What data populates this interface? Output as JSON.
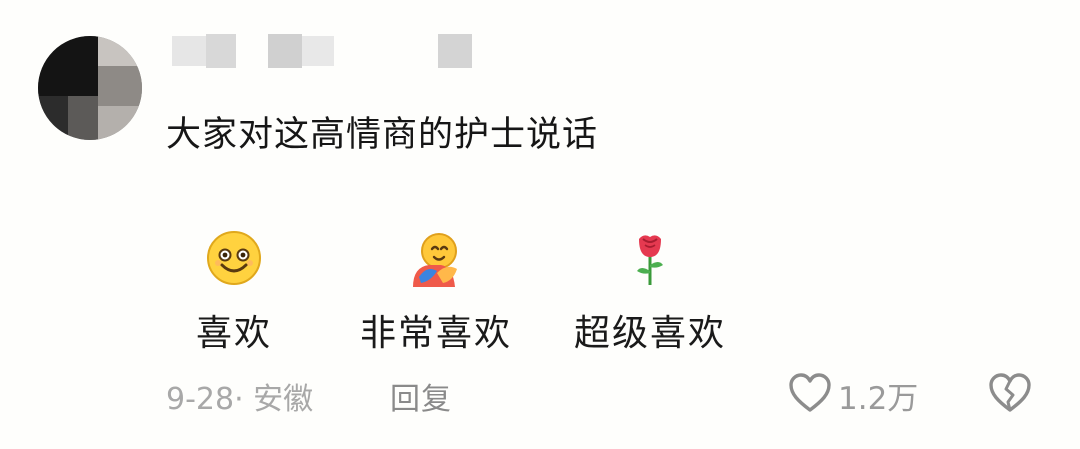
{
  "comment": {
    "text": "大家对这高情商的护士说话",
    "avatar_icon": "user-avatar-pixelated",
    "reactions": [
      {
        "icon": "smiling-face-emoji",
        "label": "喜欢"
      },
      {
        "icon": "hugging-face-emoji",
        "label": "非常喜欢"
      },
      {
        "icon": "rose-emoji",
        "label": "超级喜欢"
      }
    ],
    "meta": "9-28· 安徽",
    "reply_label": "回复",
    "like_count": "1.2万",
    "like_icon": "heart-outline-icon",
    "dislike_icon": "broken-heart-icon",
    "colors": {
      "text": "#161616",
      "meta": "#a8a8a8",
      "icon": "#8c8c8c"
    }
  }
}
